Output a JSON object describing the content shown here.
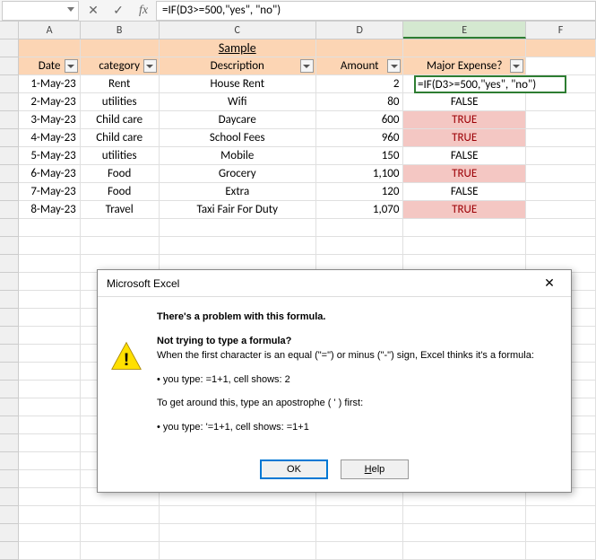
{
  "formulaBar": {
    "nameBox": "",
    "formula": "=IF(D3>=500,\"yes\", \"no\")"
  },
  "columns": [
    "A",
    "B",
    "C",
    "D",
    "E",
    "F"
  ],
  "title": "Sample",
  "headers": {
    "date": "Date",
    "category": "category",
    "description": "Description",
    "amount": "Amount",
    "majorExpense": "Major Expense?"
  },
  "rows": [
    {
      "date": "1-May-23",
      "category": "Rent",
      "description": "House Rent",
      "amount": "2",
      "major": "=IF(D3>=500,\"yes\", \"no\")"
    },
    {
      "date": "2-May-23",
      "category": "utilities",
      "description": "Wifi",
      "amount": "80",
      "major": "FALSE"
    },
    {
      "date": "3-May-23",
      "category": "Child care",
      "description": "Daycare",
      "amount": "600",
      "major": "TRUE"
    },
    {
      "date": "4-May-23",
      "category": "Child care",
      "description": "School Fees",
      "amount": "960",
      "major": "TRUE"
    },
    {
      "date": "5-May-23",
      "category": "utilities",
      "description": "Mobile",
      "amount": "150",
      "major": "FALSE"
    },
    {
      "date": "6-May-23",
      "category": "Food",
      "description": "Grocery",
      "amount": "1,100",
      "major": "TRUE"
    },
    {
      "date": "7-May-23",
      "category": "Food",
      "description": "Extra",
      "amount": "120",
      "major": "FALSE"
    },
    {
      "date": "8-May-23",
      "category": "Travel",
      "description": "Taxi Fair For Duty",
      "amount": "1,070",
      "major": "TRUE"
    }
  ],
  "blankRows": 19,
  "dialog": {
    "title": "Microsoft Excel",
    "line1": "There's a problem with this formula.",
    "line2a": "Not trying to type a formula?",
    "line2b": "When the first character is an equal (\"=\") or minus (\"-\") sign, Excel thinks it's a formula:",
    "bullet1": "• you type:   =1+1, cell shows:   2",
    "line3": "To get around this, type an apostrophe ( ' ) first:",
    "bullet2": "• you type:   '=1+1, cell shows:   =1+1",
    "ok": "OK",
    "help": "Help"
  }
}
